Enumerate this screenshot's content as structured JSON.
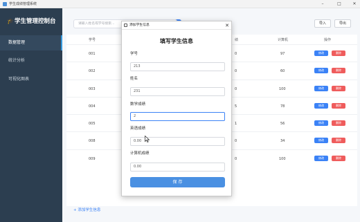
{
  "window": {
    "title": "学生成绩管理系统",
    "minimize": "–",
    "maximize": "□",
    "close": "✕"
  },
  "sidebar": {
    "brand_icon": "🎓",
    "brand": "学生管理控制台",
    "items": [
      {
        "label": "数据管理",
        "active": true
      },
      {
        "label": "统计分析",
        "active": false
      },
      {
        "label": "可视化图表",
        "active": false
      }
    ]
  },
  "toolbar": {
    "search_placeholder": "请输入姓名或学号搜索...",
    "import_label": "导入",
    "export_label": "导出"
  },
  "table": {
    "headers": {
      "id": "学号",
      "partial": "绩",
      "computer": "计算机",
      "actions": "操作"
    },
    "rows": [
      {
        "id": "001",
        "partial": "0",
        "computer": "97"
      },
      {
        "id": "002",
        "partial": "0",
        "computer": "60"
      },
      {
        "id": "003",
        "partial": "0",
        "computer": "100"
      },
      {
        "id": "004",
        "partial": "5",
        "computer": "78"
      },
      {
        "id": "005",
        "partial": "1",
        "computer": "56"
      },
      {
        "id": "008",
        "partial": "0",
        "computer": "34"
      },
      {
        "id": "009",
        "partial": "0",
        "computer": "100"
      }
    ],
    "edit_label": "修改",
    "delete_label": "删除",
    "add_link": "+ 添加学生信息"
  },
  "dialog": {
    "title": "添加学生信息",
    "close": "✕",
    "heading": "填写学生信息",
    "fields": [
      {
        "label": "学号",
        "value": "213"
      },
      {
        "label": "姓名",
        "value": "231"
      },
      {
        "label": "数学成绩",
        "value": "2"
      },
      {
        "label": "英语成绩",
        "value": "0.00"
      },
      {
        "label": "计算机成绩",
        "value": "0.00"
      }
    ],
    "save_label": "保 存"
  },
  "colors": {
    "sidebar_bg": "#2c3e50",
    "accent": "#3b82f6",
    "danger": "#ef5c5c"
  }
}
